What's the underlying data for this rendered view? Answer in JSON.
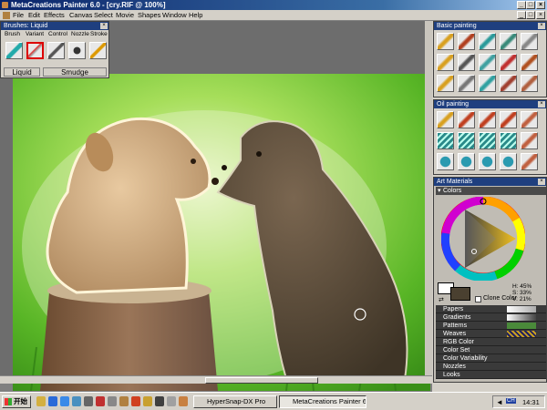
{
  "window": {
    "title": "MetaCreations Painter 6.0 - [cry.RIF @ 100%]",
    "controls": [
      "_",
      "□",
      "×"
    ],
    "doc_controls": [
      "_",
      "□",
      "×"
    ]
  },
  "menu": [
    "File",
    "Edit",
    "Effects",
    "Canvas",
    "Select",
    "Movie",
    "Shapes",
    "Window",
    "Help"
  ],
  "brushes_palette": {
    "title": "Brushes: Liquid",
    "tabs": [
      "Brush",
      "Variant",
      "Control",
      "Nozzle",
      "Stroke"
    ],
    "category": "Liquid",
    "variant": "Smudge"
  },
  "basic_painting": {
    "title": "Basic painting"
  },
  "oil_painting": {
    "title": "Oil painting"
  },
  "art_materials": {
    "title": "Art Materials",
    "colors_label": "Colors",
    "hsv": {
      "h": "H: 45%",
      "s": "S: 33%",
      "v": "V: 21%"
    },
    "clone_color": "Clone Color",
    "sections": [
      "Papers",
      "Gradients",
      "Patterns",
      "Weaves",
      "RGB Color",
      "Color Set",
      "Color Variability",
      "Nozzles",
      "Looks"
    ],
    "colors": {
      "primary": "#4a4030",
      "secondary": "#ffffff"
    }
  },
  "taskbar": {
    "start": "开始",
    "tasks": [
      "HyperSnap-DX Pro",
      "MetaCreations Painter 6...."
    ],
    "clock": "14:31",
    "tray_ime": "CH"
  }
}
